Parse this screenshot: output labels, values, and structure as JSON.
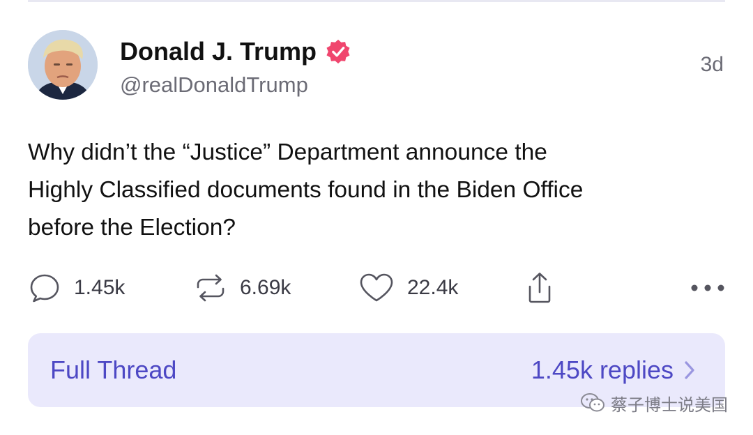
{
  "post": {
    "author": {
      "display_name": "Donald J. Trump",
      "handle": "@realDonaldTrump",
      "verified": true,
      "avatar_icon": "profile-photo"
    },
    "timestamp": "3d",
    "text_lines": [
      "Why didn’t the “Justice” Department announce the",
      "Highly Classified documents found in the Biden Office",
      "before the Election?"
    ],
    "actions": {
      "replies": {
        "icon": "comment-icon",
        "count": "1.45k"
      },
      "retweets": {
        "icon": "retweet-icon",
        "count": "6.69k"
      },
      "likes": {
        "icon": "heart-icon",
        "count": "22.4k"
      },
      "share": {
        "icon": "share-icon"
      },
      "more": {
        "icon": "more-dots-icon"
      }
    }
  },
  "thread": {
    "label": "Full Thread",
    "replies_label": "1.45k replies",
    "chevron_icon": "chevron-right-icon"
  },
  "watermark": {
    "icon": "wechat-icon",
    "text": "蔡子博士说美国"
  },
  "colors": {
    "verified_badge": "#f0466e",
    "thread_background": "#eae9fc",
    "thread_text": "#4d48c4",
    "secondary_text": "#6b6b75"
  }
}
